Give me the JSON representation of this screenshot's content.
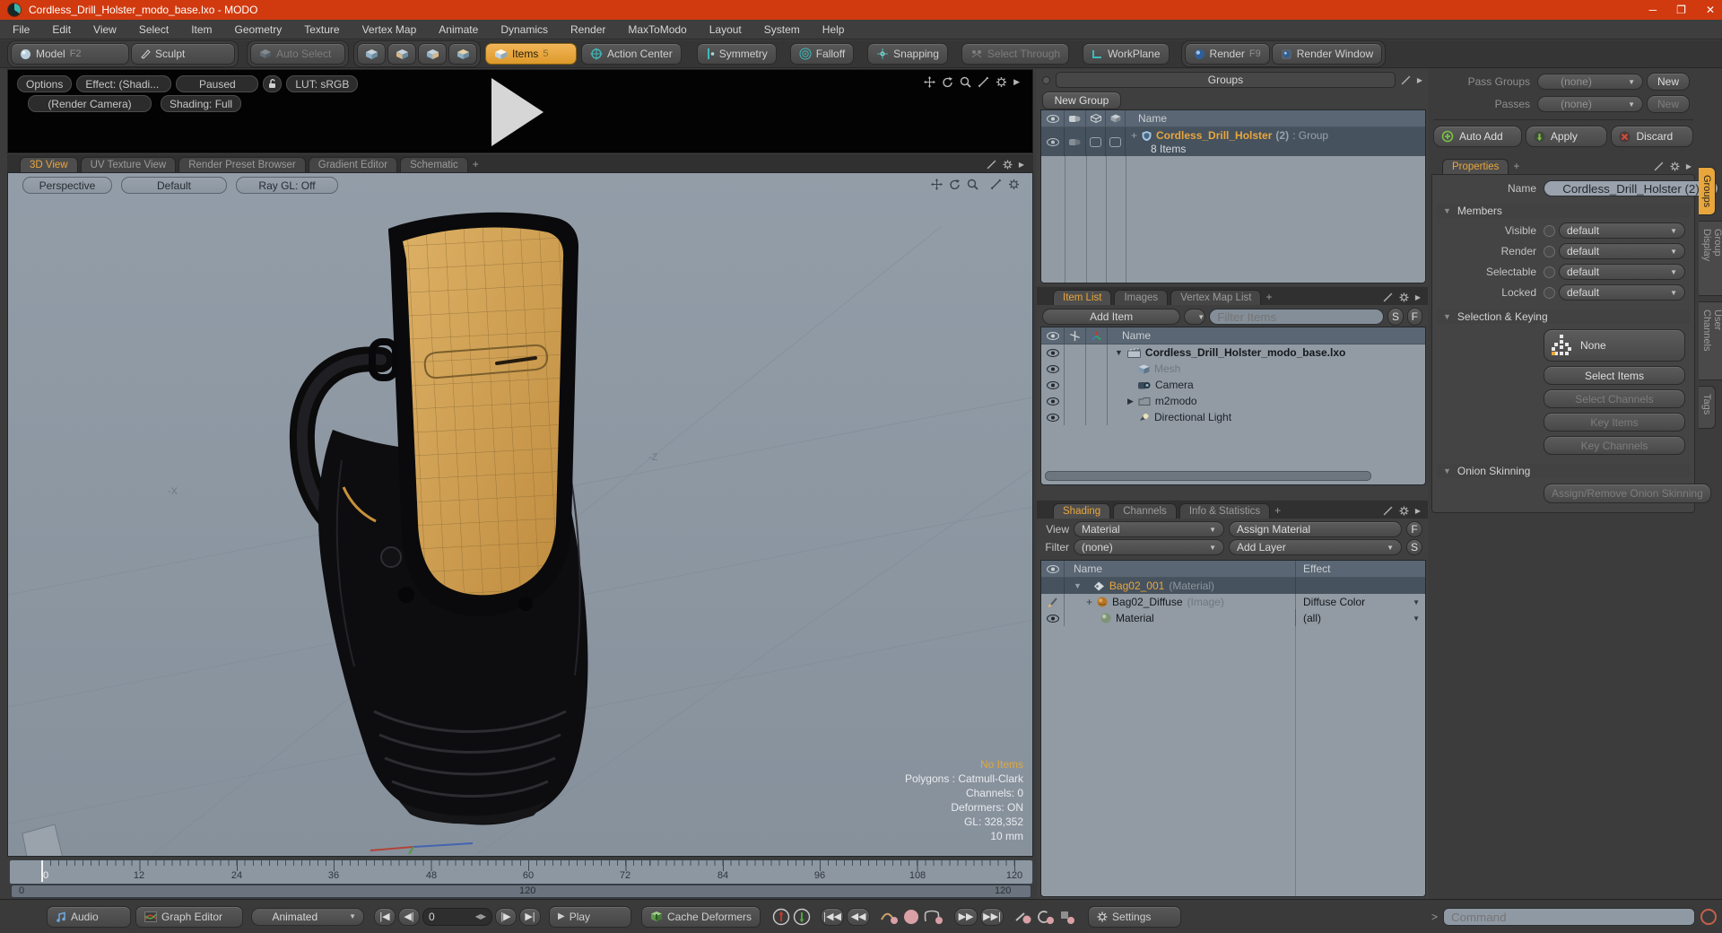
{
  "window": {
    "title": "Cordless_Drill_Holster_modo_base.lxo - MODO"
  },
  "menu": {
    "items": [
      "File",
      "Edit",
      "View",
      "Select",
      "Item",
      "Geometry",
      "Texture",
      "Vertex Map",
      "Animate",
      "Dynamics",
      "Render",
      "MaxToModo",
      "Layout",
      "System",
      "Help"
    ]
  },
  "toolbar": {
    "model": "Model",
    "model_shortcut": "F2",
    "sculpt": "Sculpt",
    "auto_select": "Auto Select",
    "items": "Items",
    "items_badge": "5",
    "action_center": "Action Center",
    "symmetry": "Symmetry",
    "falloff": "Falloff",
    "snapping": "Snapping",
    "select_through": "Select Through",
    "workplane": "WorkPlane",
    "render": "Render",
    "render_shortcut": "F9",
    "render_window": "Render Window"
  },
  "preview": {
    "options": "Options",
    "effect": "Effect: (Shadi...",
    "paused": "Paused",
    "lut": "LUT: sRGB",
    "render_camera": "(Render Camera)",
    "shading": "Shading: Full"
  },
  "viewport": {
    "tabs": [
      "3D View",
      "UV Texture View",
      "Render Preset Browser",
      "Gradient Editor",
      "Schematic"
    ],
    "add_tab": "+",
    "camera": "Perspective",
    "view_preset": "Default",
    "raygl": "Ray GL: Off",
    "axis_x": "-X",
    "axis_z": "-Z",
    "info_selection": "No Items",
    "info_lines": [
      "Polygons : Catmull-Clark",
      "Channels: 0",
      "Deformers: ON",
      "GL: 328,352",
      "10 mm"
    ]
  },
  "groups": {
    "title": "Groups",
    "new_group": "New Group",
    "name_col": "Name",
    "group_name": "Cordless_Drill_Holster",
    "group_count": "(2)",
    "group_type": ": Group",
    "group_items": "8 Items"
  },
  "item_list": {
    "tabs": [
      "Item List",
      "Images",
      "Vertex Map List"
    ],
    "add_tab": "+",
    "add_item": "Add Item",
    "filter": "Filter Items",
    "s": "S",
    "f": "F",
    "name_col": "Name",
    "rows": [
      {
        "label": "Cordless_Drill_Holster_modo_base.lxo"
      },
      {
        "label": "Mesh"
      },
      {
        "label": "Camera"
      },
      {
        "label": "m2modo"
      },
      {
        "label": "Directional Light"
      }
    ]
  },
  "shading": {
    "tabs": [
      "Shading",
      "Channels",
      "Info & Statistics"
    ],
    "add_tab": "+",
    "view_label": "View",
    "view_value": "Material",
    "assign_material": "Assign Material",
    "f": "F",
    "filter_label": "Filter",
    "filter_value": "(none)",
    "add_layer": "Add Layer",
    "s": "S",
    "name_col": "Name",
    "effect_col": "Effect",
    "rows": [
      {
        "name": "Bag02_001",
        "type": "(Material)",
        "effect": ""
      },
      {
        "name": "Bag02_Diffuse",
        "type": "(Image)",
        "effect": "Diffuse Color"
      },
      {
        "name": "Material",
        "type": "",
        "effect": "(all)"
      }
    ]
  },
  "passes": {
    "pass_groups_label": "Pass Groups",
    "pass_groups_value": "(none)",
    "pass_groups_new": "New",
    "passes_label": "Passes",
    "passes_value": "(none)",
    "passes_new": "New",
    "auto_add": "Auto Add",
    "apply": "Apply",
    "discard": "Discard"
  },
  "properties": {
    "tab": "Properties",
    "add_tab": "+",
    "name_label": "Name",
    "name_value": "Cordless_Drill_Holster (2)",
    "members_header": "Members",
    "members_rows": [
      {
        "label": "Visible",
        "value": "default"
      },
      {
        "label": "Render",
        "value": "default"
      },
      {
        "label": "Selectable",
        "value": "default"
      },
      {
        "label": "Locked",
        "value": "default"
      }
    ],
    "selection_header": "Selection & Keying",
    "none_button": "None",
    "select_items": "Select Items",
    "select_channels": "Select Channels",
    "key_items": "Key Items",
    "key_channels": "Key Channels",
    "onion_header": "Onion Skinning",
    "assign_onion": "Assign/Remove Onion Skinning"
  },
  "side_tabs": {
    "items": [
      "Groups",
      "Group Display",
      "User Channels",
      "Tags"
    ]
  },
  "timeline": {
    "labels": [
      "0",
      "12",
      "24",
      "36",
      "48",
      "60",
      "72",
      "84",
      "96",
      "108",
      "120"
    ],
    "range_start": "0",
    "range_mid": "120",
    "range_end": "120"
  },
  "transport": {
    "audio": "Audio",
    "graph_editor": "Graph Editor",
    "animated": "Animated",
    "frame": "0",
    "play": "Play",
    "cache_deformers": "Cache Deformers",
    "settings": "Settings"
  },
  "command": {
    "prompt": ">",
    "placeholder": "Command"
  },
  "colors": {
    "accent": "#e9a63c",
    "titlebar": "#d13a0f",
    "viewport_bg": "#8c96a1",
    "selection_row": "#46525e"
  }
}
